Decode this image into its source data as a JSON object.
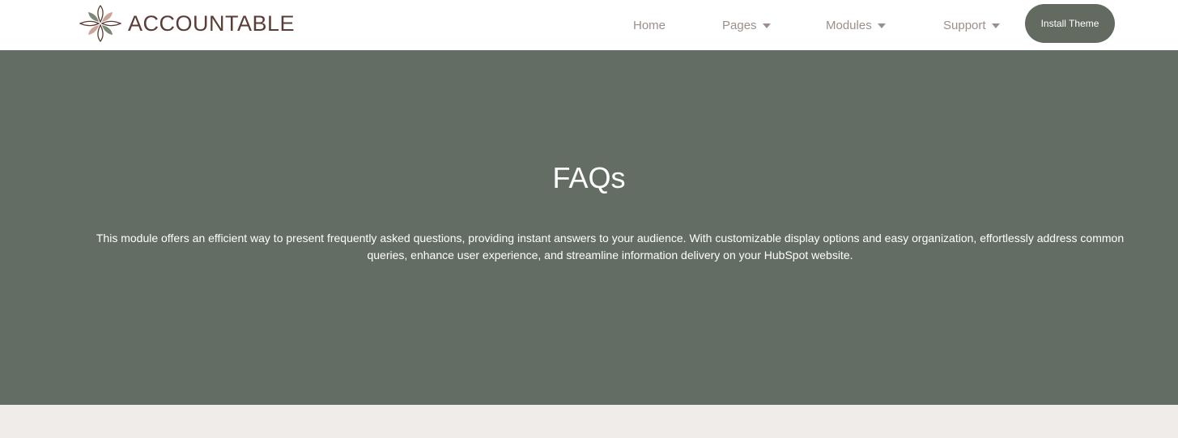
{
  "brand": {
    "name": "ACCOUNTABLE",
    "colors": {
      "text": "#5a3d36",
      "leaf_dark": "#5a3d36",
      "leaf_rose": "#c9a59a",
      "leaf_green": "#7a8a77"
    }
  },
  "nav": {
    "items": [
      {
        "label": "Home",
        "has_dropdown": false
      },
      {
        "label": "Pages",
        "has_dropdown": true
      },
      {
        "label": "Modules",
        "has_dropdown": true
      },
      {
        "label": "Support",
        "has_dropdown": true
      }
    ],
    "cta_label": "Install Theme",
    "icons": {
      "dropdown": "caret-down-icon"
    }
  },
  "hero": {
    "title": "FAQs",
    "description": "This module offers an efficient way to present frequently asked questions, providing instant answers to your audience. With customizable display options and easy organization, effortlessly address common queries, enhance user experience, and streamline information delivery on your HubSpot website.",
    "background": "#636d63"
  },
  "colors": {
    "nav_text": "#9c8f8a",
    "cta_bg": "#636b61",
    "page_bg": "#f0ecea"
  }
}
